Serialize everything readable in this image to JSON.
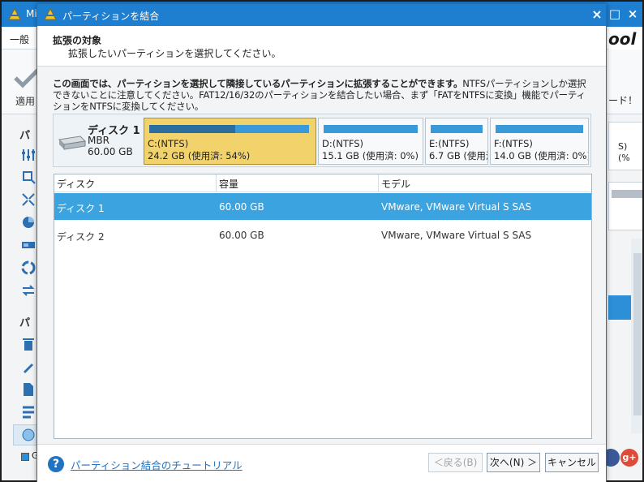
{
  "app": {
    "title_partial": "Mi",
    "tab_partial": "一般",
    "apply_partial": "適用",
    "sidebar_head1": "パ",
    "sidebar_head2": "パ",
    "logo_partial": "ool",
    "toolbar_partial": "ード！",
    "card1_line1": "S)",
    "card1_line2": "(%",
    "status_partial": "G",
    "win_buttons": [
      "□",
      "×"
    ]
  },
  "dialog": {
    "title": "パーティションを結合",
    "close_glyph": "×",
    "header": {
      "title": "拡張の対象",
      "subtitle": "拡張したいパーティションを選択してください。"
    },
    "description": {
      "bold": "この画面では、パーティションを選択して隣接しているパーティションに拡張することができます。",
      "rest": "NTFSパーティションしか選択できないことに注意してください。FAT12/16/32のパーティションを結合したい場合、まず「FATをNTFSに変換」機能でパーティションをNTFSに変換してください。"
    },
    "disk_map": {
      "name": "ディスク 1",
      "type": "MBR",
      "size": "60.00 GB",
      "partitions": [
        {
          "name": "C:(NTFS)",
          "info": "24.2 GB (使用済: 54%)",
          "used": 0.54,
          "selected": true
        },
        {
          "name": "D:(NTFS)",
          "info": "15.1 GB (使用済: 0%)",
          "used": 0.0,
          "selected": false
        },
        {
          "name": "E:(NTFS)",
          "info": "6.7 GB (使用済: 0%)",
          "used": 0.0,
          "selected": false
        },
        {
          "name": "F:(NTFS)",
          "info": "14.0 GB (使用済: 0%)",
          "used": 0.0,
          "selected": false
        }
      ]
    },
    "table": {
      "columns": [
        "ディスク",
        "容量",
        "モデル"
      ],
      "rows": [
        {
          "disk": "ディスク 1",
          "capacity": "60.00 GB",
          "model": "VMware, VMware Virtual S SAS",
          "selected": true
        },
        {
          "disk": "ディスク 2",
          "capacity": "60.00 GB",
          "model": "VMware, VMware Virtual S SAS",
          "selected": false
        }
      ]
    },
    "footer": {
      "help_glyph": "?",
      "help_link": "パーティション結合のチュートリアル",
      "back": "＜戻る(B)",
      "next": "次へ(N) ＞",
      "cancel": "キャンセル"
    }
  },
  "colors": {
    "title_bar": "#1e7fd1",
    "selection": "#3aa3e0",
    "partition_selected": "#f2d26a",
    "used_bar": "#2b6d9f",
    "free_bar": "#3a9ad9"
  }
}
